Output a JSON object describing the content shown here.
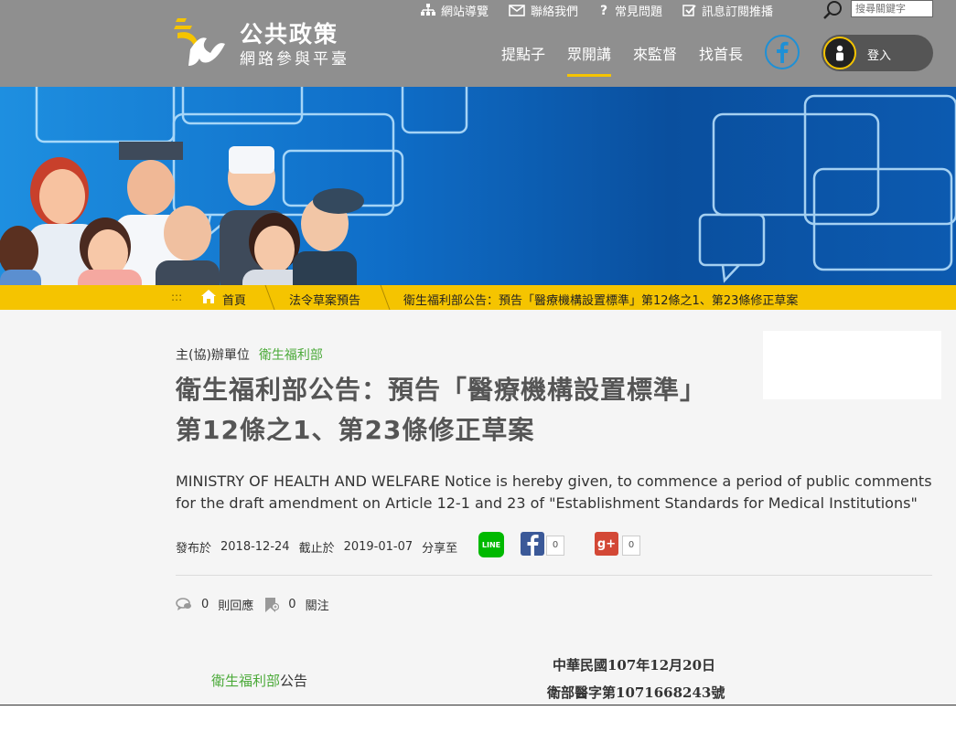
{
  "header": {
    "logo_title": "公共政策",
    "logo_subtitle": "網路參與平臺",
    "utils": {
      "sitemap": "網站導覽",
      "contact": "聯絡我們",
      "faq": "常見問題",
      "subscribe": "訊息訂閱推播"
    },
    "search_placeholder": "搜尋關鍵字",
    "nav": [
      "提點子",
      "眾開講",
      "來監督",
      "找首長"
    ],
    "login": "登入"
  },
  "breadcrumb": {
    "home": "首頁",
    "level2": "法令草案預告",
    "level3": "衛生福利部公告：預告「醫療機構設置標準」第12條之1、第23條修正草案"
  },
  "article": {
    "organizer_label": "主(協)辦單位",
    "organizer_name": "衛生福利部",
    "title_line1": "衛生福利部公告：預告「醫療機構設置標準」",
    "title_line2": "第12條之1、第23條修正草案",
    "subtitle_en": "MINISTRY OF HEALTH AND WELFARE Notice is hereby given, to commence a period of public comments for the draft amendment on Article 12-1 and 23 of \"Establishment Standards for Medical Institutions\"",
    "published_label": "發布於",
    "published_date": "2018-12-24",
    "deadline_label": "截止於",
    "deadline_date": "2019-01-07",
    "share_label": "分享至",
    "share_line": "LINE",
    "share_gplus": "g+",
    "fb_count": "0",
    "gplus_count": "0",
    "comments_count": "0",
    "comments_label": "則回應",
    "follow_count": "0",
    "follow_label": "關注"
  },
  "document": {
    "org": "衛生福利部",
    "notice_suffix": "公告",
    "date": "中華民國107年12月20日",
    "number": "衛部醫字第1071668243號"
  },
  "colors": {
    "accent_yellow": "#f5c400",
    "header_gray": "#8f8f8f",
    "org_green": "#4caa3a",
    "line_green": "#00b900",
    "facebook_blue": "#3b5998",
    "gplus_red": "#d34836"
  }
}
